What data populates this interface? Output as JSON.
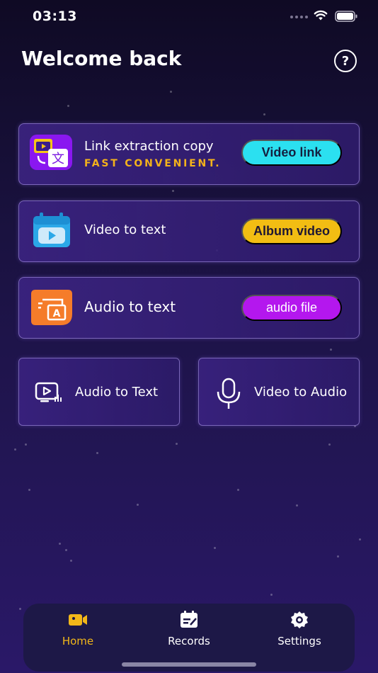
{
  "status_bar": {
    "time": "03:13"
  },
  "header": {
    "title": "Welcome back",
    "help_symbol": "?"
  },
  "cards": [
    {
      "title": "Link extraction copy",
      "subtitle": "FAST  CONVENIENT.",
      "button": "Video link",
      "icon": "link-translate-icon",
      "button_color": "#2be0f0"
    },
    {
      "title": "Video to text",
      "button": "Album video",
      "icon": "video-player-icon",
      "button_color": "#f2bd13"
    },
    {
      "title": "Audio to text",
      "button": "audio file",
      "icon": "audio-text-icon",
      "button_color": "#b417ee"
    }
  ],
  "small_cards": [
    {
      "label": "Audio to Text",
      "icon": "screen-audio-icon"
    },
    {
      "label": "Video to Audio",
      "icon": "microphone-icon"
    }
  ],
  "tab_bar": {
    "tabs": [
      {
        "label": "Home",
        "icon": "video-camera-icon",
        "active": true
      },
      {
        "label": "Records",
        "icon": "clipboard-icon",
        "active": false
      },
      {
        "label": "Settings",
        "icon": "gear-icon",
        "active": false
      }
    ]
  },
  "colors": {
    "accent": "#f2b719",
    "background": "#1a1240"
  }
}
